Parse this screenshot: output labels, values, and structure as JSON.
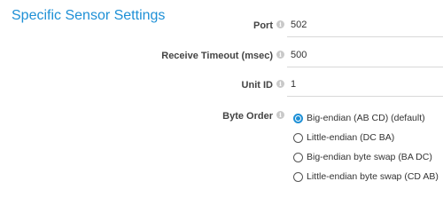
{
  "section": {
    "title": "Specific Sensor Settings"
  },
  "info_glyph": "i",
  "fields": [
    {
      "label": "Port",
      "value": "502"
    },
    {
      "label": "Receive Timeout (msec)",
      "value": "500"
    },
    {
      "label": "Unit ID",
      "value": "1"
    }
  ],
  "byte_order": {
    "label": "Byte Order",
    "selected_index": 0,
    "options": [
      "Big-endian (AB CD) (default)",
      "Little-endian (DC BA)",
      "Big-endian byte swap (BA DC)",
      "Little-endian byte swap (CD AB)"
    ]
  },
  "colors": {
    "accent": "#1e90d6",
    "label": "#444444",
    "divider": "#d8d8d8"
  }
}
